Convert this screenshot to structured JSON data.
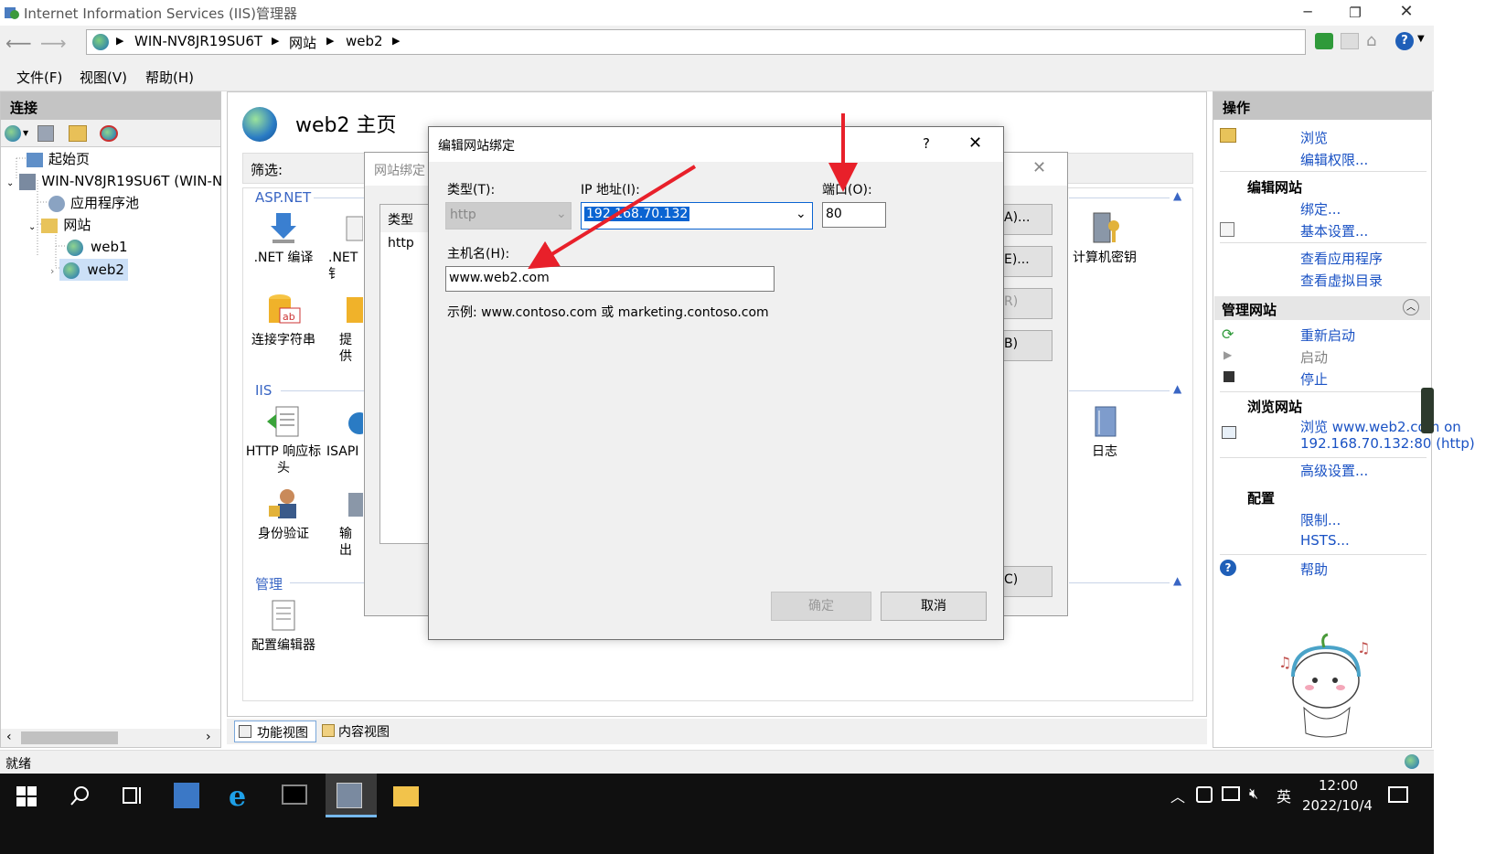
{
  "window": {
    "title": "Internet Information Services (IIS)管理器"
  },
  "address": {
    "crumbs": [
      "WIN-NV8JR19SU6T",
      "网站",
      "web2"
    ]
  },
  "menu": [
    "文件(F)",
    "视图(V)",
    "帮助(H)"
  ],
  "connections": {
    "title": "连接",
    "tree": {
      "start": "起始页",
      "server": "WIN-NV8JR19SU6T (WIN-N",
      "app_pools": "应用程序池",
      "sites": "网站",
      "site1": "web1",
      "site2": "web2"
    }
  },
  "main": {
    "title": "web2 主页",
    "filter_label": "筛选:",
    "groups": {
      "aspnet": "ASP.NET",
      "iis": "IIS",
      "manage": "管理"
    },
    "tiles": {
      "net_compile": ".NET 编译",
      "net_cut": ".NET 钅",
      "machine_key": "计算机密钥",
      "conn_str": "连接字符串",
      "providers": "提供",
      "http_headers": "HTTP 响应标头",
      "isapi": "ISAPI",
      "logging": "日志",
      "auth": "身份验证",
      "output": "输出",
      "config_editor": "配置编辑器"
    },
    "bottom_tabs": [
      "功能视图",
      "内容视图"
    ]
  },
  "bindings_dialog": {
    "title": "网站绑定",
    "col_type": "类型",
    "row_type": "http",
    "btn_partials": [
      "A)...",
      "E)...",
      "R)",
      "B)",
      "C)"
    ]
  },
  "edit_dialog": {
    "title": "编辑网站绑定",
    "help": "?",
    "type_label": "类型(T):",
    "type_value": "http",
    "ip_label": "IP 地址(I):",
    "ip_value": "192.168.70.132",
    "port_label": "端口(O):",
    "port_value": "80",
    "host_label": "主机名(H):",
    "host_value": "www.web2.com",
    "example": "示例: www.contoso.com 或 marketing.contoso.com",
    "ok": "确定",
    "cancel": "取消"
  },
  "actions": {
    "title": "操作",
    "browse": "浏览",
    "edit_perm": "编辑权限...",
    "edit_site_head": "编辑网站",
    "bindings": "绑定...",
    "basic": "基本设置...",
    "view_apps": "查看应用程序",
    "view_vdirs": "查看虚拟目录",
    "manage_head": "管理网站",
    "restart": "重新启动",
    "start": "启动",
    "stop": "停止",
    "browse_head": "浏览网站",
    "browse_link1": "浏览 www.web2.com on",
    "browse_link2": "192.168.70.132:80 (http)",
    "advanced": "高级设置...",
    "config_head": "配置",
    "limits": "限制...",
    "hsts": "HSTS...",
    "help": "帮助"
  },
  "status": {
    "text": "就绪"
  },
  "taskbar": {
    "lang": "英",
    "time": "12:00",
    "date": "2022/10/4"
  },
  "colors": {
    "accent_link": "#1a52c4",
    "section_head": "#3a66c4",
    "taskbar_bg": "#101010",
    "selection": "#0a64d2",
    "arrow": "#e8202a"
  }
}
